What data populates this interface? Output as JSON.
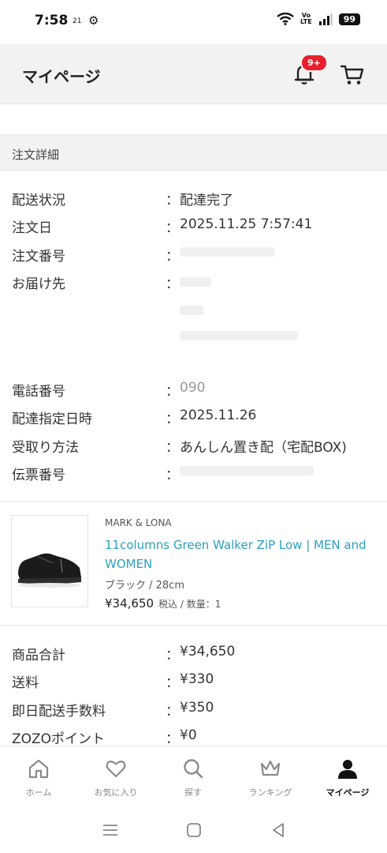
{
  "status_bar": {
    "time": "7:58",
    "date_badge": "21",
    "volte_top": "Vo",
    "volte_bottom": "LTE",
    "battery": "99"
  },
  "header": {
    "title": "マイページ",
    "notification_badge": "9+"
  },
  "section": {
    "title": "注文詳細"
  },
  "details": [
    {
      "label": "配送状況",
      "value": "配達完了"
    },
    {
      "label": "注文日",
      "value": "2025.11.25 7:57:41"
    },
    {
      "label": "注文番号",
      "value": ""
    },
    {
      "label": "お届け先",
      "value": ""
    },
    {
      "label": "電話番号",
      "value": "090"
    },
    {
      "label": "配達指定日時",
      "value": "2025.11.26"
    },
    {
      "label": "受取り方法",
      "value": "あんしん置き配（宅配BOX)"
    },
    {
      "label": "伝票番号",
      "value": ""
    }
  ],
  "colon": "：",
  "product": {
    "brand": "MARK & LONA",
    "name": "11columns Green Walker ZiP Low | MEN and WOMEN",
    "variant": "ブラック / 28cm",
    "price": "¥34,650",
    "price_note": "税込 / 数量：1"
  },
  "totals": [
    {
      "label": "商品合計",
      "value": "¥34,650"
    },
    {
      "label": "送料",
      "value": "¥330"
    },
    {
      "label": "即日配送手数料",
      "value": "¥350"
    },
    {
      "label": "ZOZOポイント",
      "value": "¥0"
    }
  ],
  "bottom_nav": [
    {
      "label": "ホーム",
      "icon": "home-icon"
    },
    {
      "label": "お気に入り",
      "icon": "heart-icon"
    },
    {
      "label": "探す",
      "icon": "search-icon"
    },
    {
      "label": "ランキング",
      "icon": "crown-icon"
    },
    {
      "label": "マイページ",
      "icon": "person-icon",
      "active": true
    }
  ],
  "colors": {
    "link": "#2a9fbf",
    "badge": "#e8202e",
    "header_bg": "#f2f2f2"
  }
}
